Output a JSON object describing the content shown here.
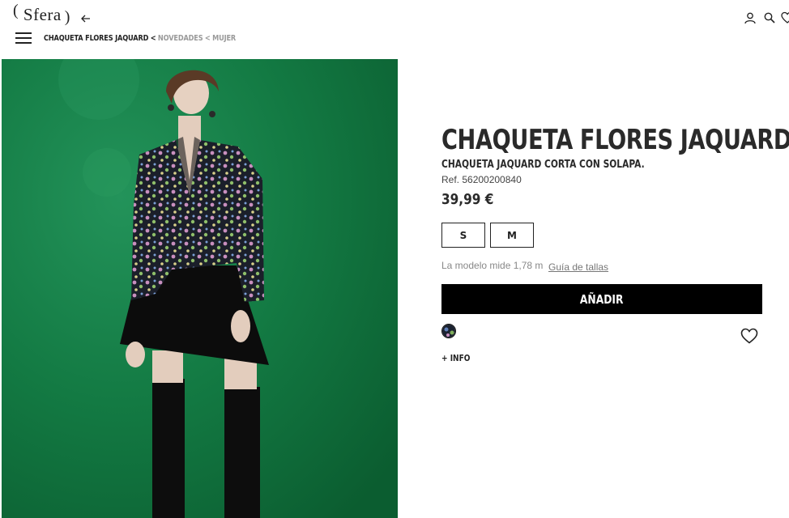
{
  "header": {
    "logo_text": "Sfera",
    "breadcrumb": {
      "current": "CHAQUETA FLORES JAQUARD",
      "sep": "<",
      "links": [
        "NOVEDADES",
        "MUJER"
      ]
    },
    "icons": [
      "user-icon",
      "search-icon",
      "heart-icon"
    ]
  },
  "product": {
    "title": "CHAQUETA FLORES JAQUARD",
    "subtitle": "CHAQUETA JAQUARD CORTA CON SOLAPA.",
    "ref": "Ref. 56200200840",
    "price": "39,99 €",
    "sizes": [
      "S",
      "M"
    ],
    "model_note": "La modelo mide 1,78 m",
    "size_guide": "Guía de tallas",
    "add_label": "AÑADIR",
    "more_info": "+ INFO"
  },
  "colors": {
    "image_background": "#157a40",
    "button": "#000000",
    "breadcrumb_link": "#9a9a9a"
  }
}
